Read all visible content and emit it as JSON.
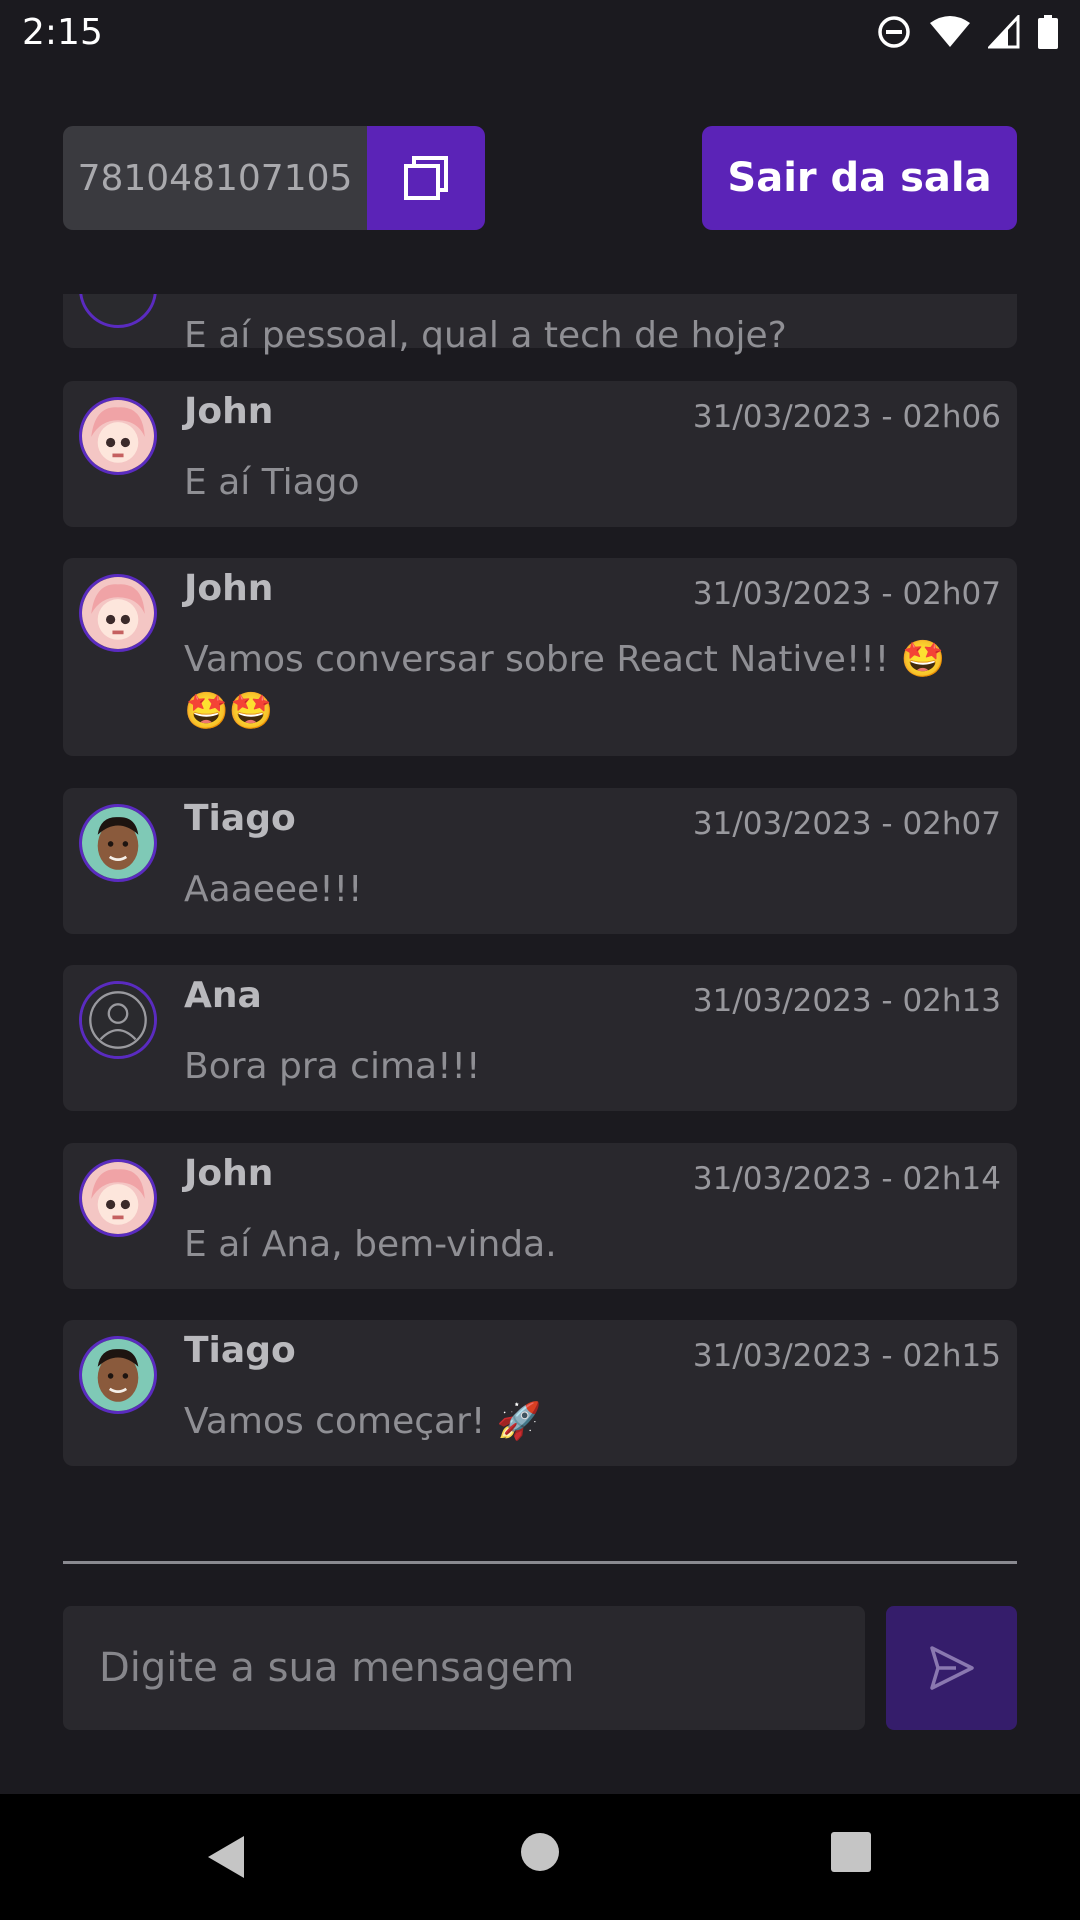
{
  "status_bar": {
    "time": "2:15",
    "icons": [
      "do-not-disturb-icon",
      "wifi-icon",
      "cell-signal-icon",
      "battery-icon"
    ]
  },
  "header": {
    "room_code": "781048107105",
    "copy_icon": "copy-icon",
    "leave_label": "Sair da sala"
  },
  "messages": [
    {
      "author": "",
      "time": "",
      "text": "E aí pessoal, qual a tech de hoje?",
      "avatar": ""
    },
    {
      "author": "John",
      "time": "31/03/2023 - 02h06",
      "text": "E aí Tiago",
      "avatar": "anime-girl"
    },
    {
      "author": "John",
      "time": "31/03/2023 - 02h07",
      "text": "Vamos conversar sobre React Native!!! 🤩🤩🤩",
      "avatar": "anime-girl"
    },
    {
      "author": "Tiago",
      "time": "31/03/2023 - 02h07",
      "text": "Aaaeee!!!",
      "avatar": "man-photo"
    },
    {
      "author": "Ana",
      "time": "31/03/2023 - 02h13",
      "text": "Bora pra cima!!!",
      "avatar": "default-user"
    },
    {
      "author": "John",
      "time": "31/03/2023 - 02h14",
      "text": "E aí Ana, bem-vinda.",
      "avatar": "anime-girl"
    },
    {
      "author": "Tiago",
      "time": "31/03/2023 - 02h15",
      "text": "Vamos começar! 🚀",
      "avatar": "man-photo"
    }
  ],
  "composer": {
    "placeholder": "Digite a sua mensagem",
    "value": "",
    "send_icon": "send-icon"
  },
  "colors": {
    "accent": "#5b23b7",
    "background": "#1b1a1f",
    "card": "#29282d",
    "avatar_border": "#5a2bc0"
  },
  "nav_bar": [
    "back-icon",
    "home-icon",
    "recents-icon"
  ]
}
